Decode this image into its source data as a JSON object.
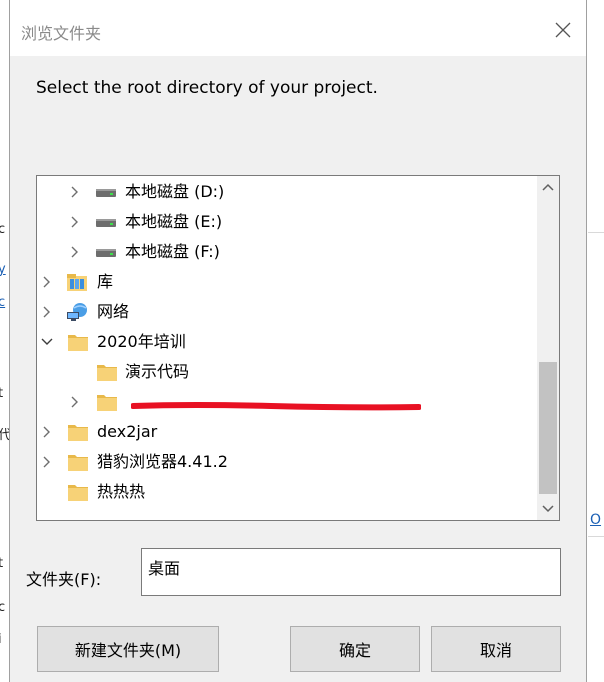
{
  "dialog": {
    "title": "浏览文件夹",
    "prompt": "Select the root directory of your project."
  },
  "tree": {
    "items": [
      {
        "label": "本地磁盘 (D:)",
        "icon": "drive-icon",
        "expandable": true,
        "expanded": false
      },
      {
        "label": "本地磁盘 (E:)",
        "icon": "drive-icon",
        "expandable": true,
        "expanded": false
      },
      {
        "label": "本地磁盘 (F:)",
        "icon": "drive-icon",
        "expandable": true,
        "expanded": false
      },
      {
        "label": "库",
        "icon": "library-icon",
        "expandable": true,
        "expanded": false
      },
      {
        "label": "网络",
        "icon": "network-icon",
        "expandable": true,
        "expanded": false
      },
      {
        "label": "2020年培训",
        "icon": "folder-icon",
        "expandable": true,
        "expanded": true
      },
      {
        "label": "演示代码",
        "icon": "folder-icon",
        "expandable": false,
        "expanded": false
      },
      {
        "label": "",
        "icon": "folder-icon",
        "expandable": true,
        "expanded": false,
        "note": "label obscured by red strike"
      },
      {
        "label": "dex2jar",
        "icon": "folder-icon",
        "expandable": true,
        "expanded": false
      },
      {
        "label": "猎豹浏览器4.41.2",
        "icon": "folder-icon",
        "expandable": true,
        "expanded": false
      },
      {
        "label": "热热热",
        "icon": "folder-icon",
        "expandable": false,
        "expanded": false
      }
    ]
  },
  "folder_field": {
    "label": "文件夹(F):",
    "value": "桌面"
  },
  "buttons": {
    "new_folder": "新建文件夹(M)",
    "ok": "确定",
    "cancel": "取消"
  },
  "colors": {
    "dialog_bg": "#f0f0f0",
    "folder_yellow": "#f7d277",
    "drive_gray": "#6d6d6d",
    "red_mark": "#e81123"
  }
}
